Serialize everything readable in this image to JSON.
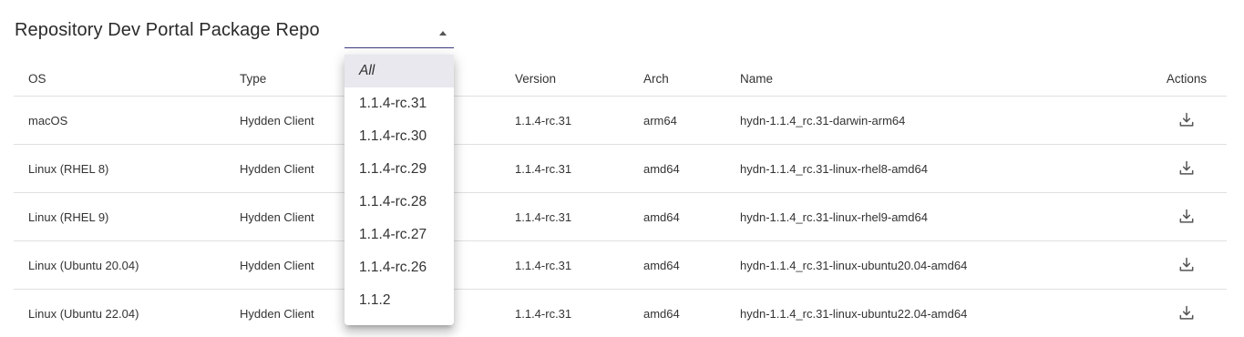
{
  "header": {
    "title": "Repository Dev Portal Package Repo",
    "version_select": {
      "value": ""
    }
  },
  "table": {
    "columns": [
      "OS",
      "Type",
      "Version",
      "Arch",
      "Name",
      "Actions"
    ],
    "rows": [
      {
        "os": "macOS",
        "type": "Hydden Client",
        "version": "1.1.4-rc.31",
        "arch": "arm64",
        "name": "hydn-1.1.4_rc.31-darwin-arm64",
        "action_icon": "download-icon"
      },
      {
        "os": "Linux (RHEL 8)",
        "type": "Hydden Client",
        "version": "1.1.4-rc.31",
        "arch": "amd64",
        "name": "hydn-1.1.4_rc.31-linux-rhel8-amd64",
        "action_icon": "download-icon"
      },
      {
        "os": "Linux (RHEL 9)",
        "type": "Hydden Client",
        "version": "1.1.4-rc.31",
        "arch": "amd64",
        "name": "hydn-1.1.4_rc.31-linux-rhel9-amd64",
        "action_icon": "download-icon"
      },
      {
        "os": "Linux (Ubuntu 20.04)",
        "type": "Hydden Client",
        "version": "1.1.4-rc.31",
        "arch": "amd64",
        "name": "hydn-1.1.4_rc.31-linux-ubuntu20.04-amd64",
        "action_icon": "download-icon"
      },
      {
        "os": "Linux (Ubuntu 22.04)",
        "type": "Hydden Client",
        "version": "1.1.4-rc.31",
        "arch": "amd64",
        "name": "hydn-1.1.4_rc.31-linux-ubuntu22.04-amd64",
        "action_icon": "download-icon"
      }
    ]
  },
  "dropdown": {
    "selected": "All",
    "options": [
      "All",
      "1.1.4-rc.31",
      "1.1.4-rc.30",
      "1.1.4-rc.29",
      "1.1.4-rc.28",
      "1.1.4-rc.27",
      "1.1.4-rc.26",
      "1.1.2"
    ]
  },
  "colors": {
    "select_underline": "#3d3a80",
    "selected_option_bg": "#e8e8ee",
    "row_divider": "#e0e0e0"
  }
}
